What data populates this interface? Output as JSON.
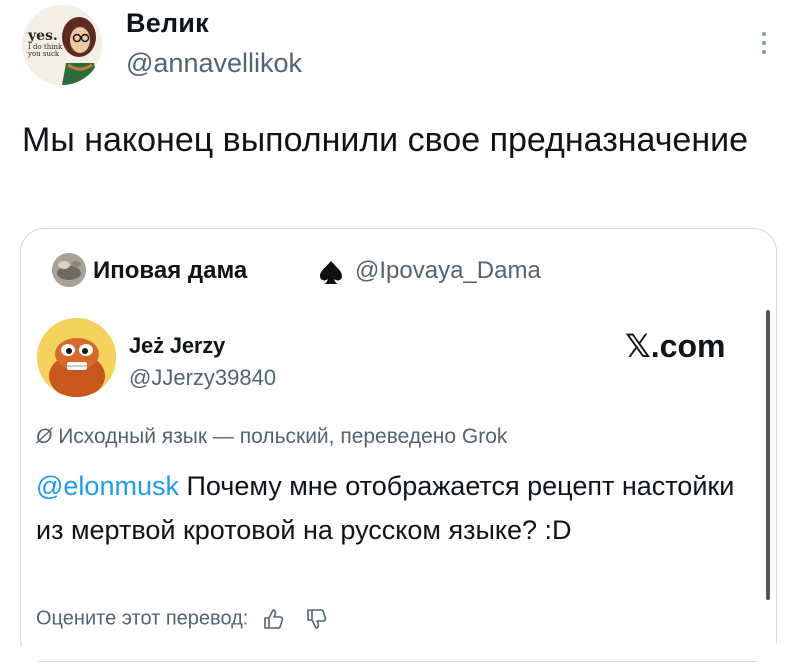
{
  "author": {
    "name": "Велик",
    "handle": "@annavellikok",
    "avatar_text_big": "yes.",
    "avatar_text_small": "I do think you suck"
  },
  "tweet": {
    "text": "Мы наконец выполнили свое предназначение"
  },
  "quote": {
    "name": "Иповая дама",
    "handle": "@Ipovaya_Dama"
  },
  "embedded": {
    "name": "Jeż Jerzy",
    "handle": "@JJerzy39840",
    "site": "𝕏.com",
    "translation_note": "Исходный язык — польский, переведено Grok",
    "mention": "@elonmusk",
    "text": " Почему мне отображается рецепт настойки из мертвой кротовой на русском языке? :D",
    "rate_label": "Оцените этот перевод:"
  },
  "colors": {
    "link": "#1d9bf0",
    "secondary_text": "#536471",
    "border": "#cfd9de"
  },
  "icons": {
    "more": "more-icon",
    "spade": "spade-icon",
    "translate": "translate-icon",
    "like": "thumbs-up-icon",
    "dislike": "thumbs-down-icon"
  }
}
